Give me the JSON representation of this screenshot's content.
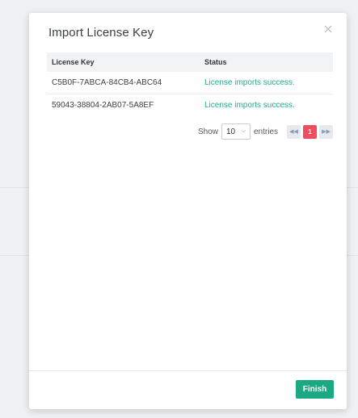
{
  "dialog": {
    "title": "Import License Key",
    "close_icon": "close-icon"
  },
  "table": {
    "columns": [
      "License Key",
      "Status"
    ],
    "rows": [
      {
        "license_key": "C5B0F-7ABCA-84CB4-ABC64",
        "status": "License imports success."
      },
      {
        "license_key": "59043-38804-2AB07-5A8EF",
        "status": "License imports success."
      }
    ]
  },
  "pagination": {
    "show_label": "Show",
    "entries_value": "10",
    "entries_label": "entries",
    "first_icon": "double-chevron-left-icon",
    "current_page": "1",
    "last_icon": "double-chevron-right-icon"
  },
  "footer": {
    "finish_label": "Finish"
  },
  "colors": {
    "status_success": "#1fae8a",
    "primary_button": "#1aa983",
    "active_page": "#ef4e5e"
  }
}
